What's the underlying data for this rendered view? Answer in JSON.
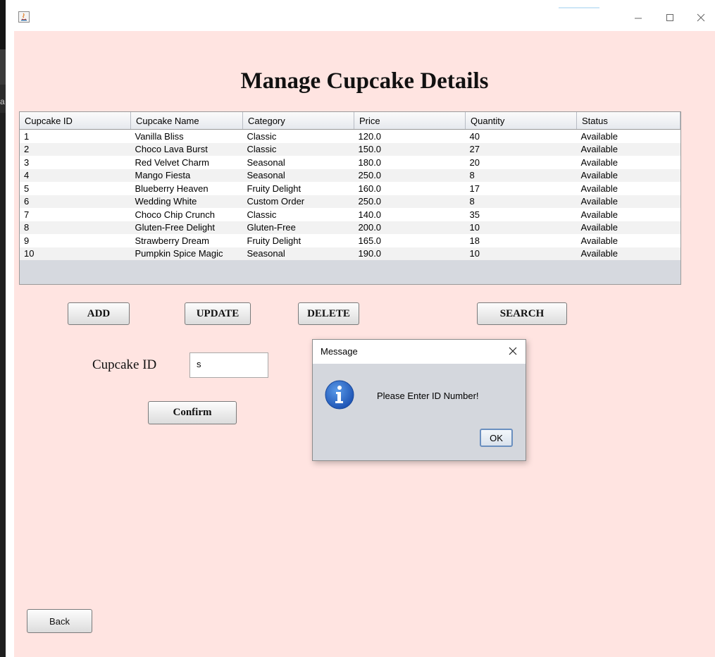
{
  "window": {
    "title": ""
  },
  "page": {
    "title": "Manage Cupcake Details"
  },
  "desktop": {
    "edge_char": "a"
  },
  "table": {
    "headers": [
      "Cupcake ID",
      "Cupcake Name",
      "Category",
      "Price",
      "Quantity",
      "Status"
    ],
    "rows": [
      [
        "1",
        "Vanilla Bliss",
        "Classic",
        "120.0",
        "40",
        "Available"
      ],
      [
        "2",
        "Choco Lava Burst",
        "Classic",
        "150.0",
        "27",
        "Available"
      ],
      [
        "3",
        "Red Velvet Charm",
        "Seasonal",
        "180.0",
        "20",
        "Available"
      ],
      [
        "4",
        "Mango Fiesta",
        "Seasonal",
        "250.0",
        "8",
        "Available"
      ],
      [
        "5",
        "Blueberry Heaven",
        "Fruity Delight",
        "160.0",
        "17",
        "Available"
      ],
      [
        "6",
        "Wedding White",
        "Custom Order",
        "250.0",
        "8",
        "Available"
      ],
      [
        "7",
        "Choco Chip Crunch",
        "Classic",
        "140.0",
        "35",
        "Available"
      ],
      [
        "8",
        "Gluten-Free Delight",
        "Gluten-Free",
        "200.0",
        "10",
        "Available"
      ],
      [
        "9",
        "Strawberry Dream",
        "Fruity Delight",
        "165.0",
        "18",
        "Available"
      ],
      [
        "10",
        "Pumpkin Spice Magic",
        "Seasonal",
        "190.0",
        "10",
        "Available"
      ]
    ]
  },
  "actions": {
    "add": "ADD",
    "update": "UPDATE",
    "delete": "DELETE",
    "search": "SEARCH"
  },
  "form": {
    "id_label": "Cupcake ID",
    "id_value": "s",
    "confirm": "Confirm"
  },
  "nav": {
    "back": "Back"
  },
  "dialog": {
    "title": "Message",
    "message": "Please Enter ID Number!",
    "ok": "OK",
    "icon": "info-icon"
  },
  "colors": {
    "background": "#ffe4e1",
    "dialog_bg": "#d4d7dd",
    "info_blue": "#2f6fd0"
  }
}
